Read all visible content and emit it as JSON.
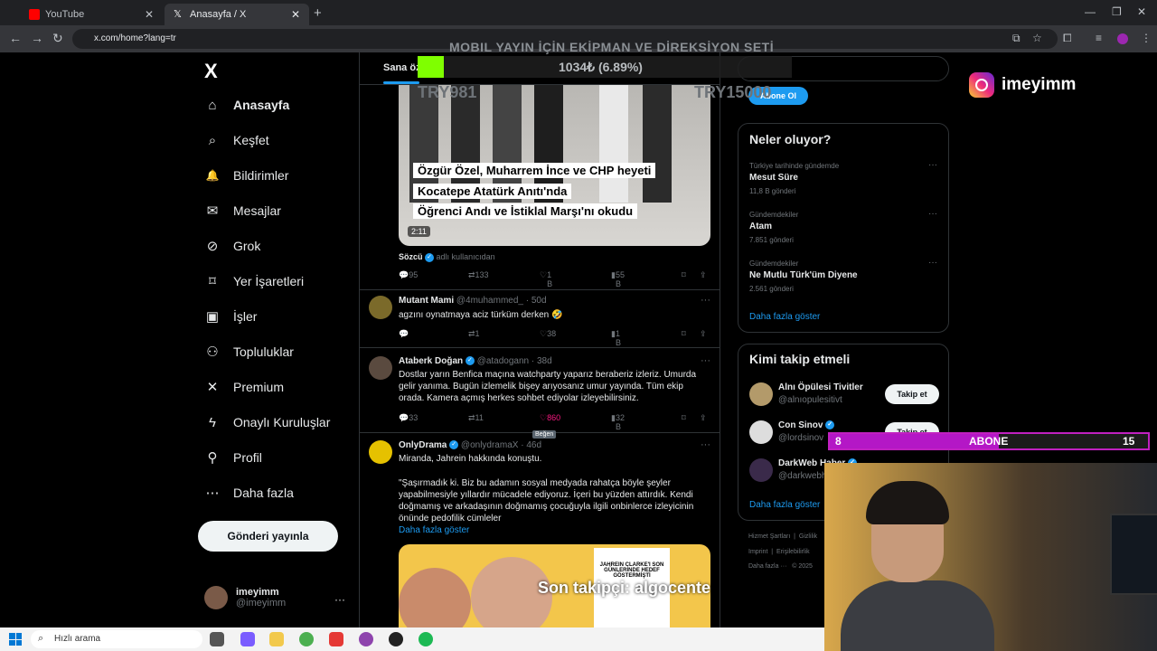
{
  "browser": {
    "tabs": [
      {
        "title": "YouTube",
        "color": "#ff0000"
      },
      {
        "title": "Anasayfa / X",
        "color": "#000000"
      }
    ],
    "url": "x.com/home?lang=tr"
  },
  "sidebar": {
    "logo": "X",
    "items": [
      {
        "label": "Anasayfa",
        "icon": "home-icon",
        "glyph": "⌂"
      },
      {
        "label": "Keşfet",
        "icon": "search-icon",
        "glyph": "⌕"
      },
      {
        "label": "Bildirimler",
        "icon": "bell-icon",
        "glyph": "🔔"
      },
      {
        "label": "Mesajlar",
        "icon": "mail-icon",
        "glyph": "✉"
      },
      {
        "label": "Grok",
        "icon": "grok-icon",
        "glyph": "⊘"
      },
      {
        "label": "Yer İşaretleri",
        "icon": "bookmark-icon",
        "glyph": "⌑"
      },
      {
        "label": "İşler",
        "icon": "briefcase-icon",
        "glyph": "▣"
      },
      {
        "label": "Topluluklar",
        "icon": "communities-icon",
        "glyph": "⚇"
      },
      {
        "label": "Premium",
        "icon": "x-premium-icon",
        "glyph": "✕"
      },
      {
        "label": "Onaylı Kuruluşlar",
        "icon": "lightning-icon",
        "glyph": "ϟ"
      },
      {
        "label": "Profil",
        "icon": "person-icon",
        "glyph": "⚲"
      },
      {
        "label": "Daha fazla",
        "icon": "more-circle-icon",
        "glyph": "⋯"
      }
    ],
    "post_button": "Gönderi yayınla",
    "profile": {
      "name": "imeyimm",
      "handle": "@imeyimm",
      "more": "···"
    }
  },
  "feed": {
    "tab": "Sana öz",
    "video": {
      "captions": [
        "Özgür Özel, Muharrem İnce ve CHP heyeti",
        "Kocatepe Atatürk Anıtı'nda",
        "Öğrenci Andı ve İstiklal Marşı'nı okudu"
      ],
      "duration": "2:11",
      "source_name": "Sözcü",
      "source_suffix": "adlı kullanıcıdan",
      "stats": {
        "replies": "95",
        "reposts": "133",
        "likes": "1 B",
        "views": "55 B"
      }
    },
    "tweets": [
      {
        "name": "Mutant Mami",
        "handle": "@4muhammed_",
        "time": "· 50d",
        "verified": false,
        "text": "agzını oynatmaya aciz türküm derken 🤣",
        "stats": {
          "replies": "",
          "reposts": "1",
          "likes": "38",
          "views": "1 B"
        }
      },
      {
        "name": "Ataberk Doğan",
        "handle": "@atadogann",
        "time": "· 38d",
        "verified": true,
        "text": "Dostlar yarın Benfica maçına watchparty yaparız beraberiz izleriz. Umurda gelir yanıma. Bugün izlemelik bişey arıyosanız umur yayında. Tüm ekip orada. Kamera açmış herkes sohbet ediyolar izleyebilirsiniz.",
        "stats": {
          "replies": "33",
          "reposts": "11",
          "likes": "860",
          "views": "32 B"
        },
        "tooltip": "Beğen"
      },
      {
        "name": "OnlyDrama",
        "handle": "@onlydramaX",
        "time": "· 46d",
        "verified": true,
        "text": "Miranda, Jahrein hakkında konuştu.",
        "quote": "\"Şaşırmadık ki. Biz bu adamın sosyal medyada rahatça böyle şeyler yapabilmesiyle yıllardır mücadele ediyoruz. İçeri bu yüzden attırdık. Kendi doğmamış ve arkadaşının doğmamış çocuğuyla ilgili onbinlerce izleyicinin önünde pedofilik cümleler",
        "show_more": "Daha fazla göster",
        "image_caption": "JAHREIN CLARKE'I SON GÜNLERİNDE HEDEF GÖSTERMİŞTİ"
      }
    ]
  },
  "right": {
    "premium_button": "Abone Ol",
    "trends_title": "Neler oluyor?",
    "trends": [
      {
        "meta": "Türkiye tarihinde gündemde",
        "name": "Mesut Süre",
        "count": "11,8 B gönderi"
      },
      {
        "meta": "Gündemdekiler",
        "name": "Atam",
        "count": "7.851 gönderi"
      },
      {
        "meta": "Gündemdekiler",
        "name": "Ne Mutlu Türk'üm Diyene",
        "count": "2.561 gönderi"
      }
    ],
    "trends_more": "Daha fazla göster",
    "who_title": "Kimi takip etmeli",
    "who": [
      {
        "name": "Alnı Öpülesi Tivitler",
        "handle": "@alnıopulesitivt",
        "button": "Takip et",
        "verified": false
      },
      {
        "name": "Con Sinov",
        "handle": "@lordsinov",
        "button": "Takip et",
        "verified": true
      },
      {
        "name": "DarkWeb Haber",
        "handle": "@darkwebhaber",
        "button": "Takip et",
        "verified": true
      }
    ],
    "who_more": "Daha fazla göster",
    "footer": [
      "Hizmet Şartları",
      "Gizlilik",
      "Imprint",
      "Erişilebilirlik",
      "Daha fazla ···",
      "© 2025"
    ]
  },
  "overlay": {
    "goal_title": "MOBIL YAYIN İÇİN EKİPMAN VE DİREKSİYON SETİ",
    "goal_amount": "1034₺ (6.89%)",
    "goal_progress": 0.0689,
    "goal_left": "TRY981",
    "goal_right": "TRY15000",
    "instagram": "imeyimm",
    "sub_goal": {
      "current": "8",
      "label": "ABONE",
      "target": "15",
      "progress": 0.53
    },
    "last_follower": "Son takipçi: algocente"
  },
  "taskbar": {
    "search_placeholder": "Hızlı arama"
  }
}
